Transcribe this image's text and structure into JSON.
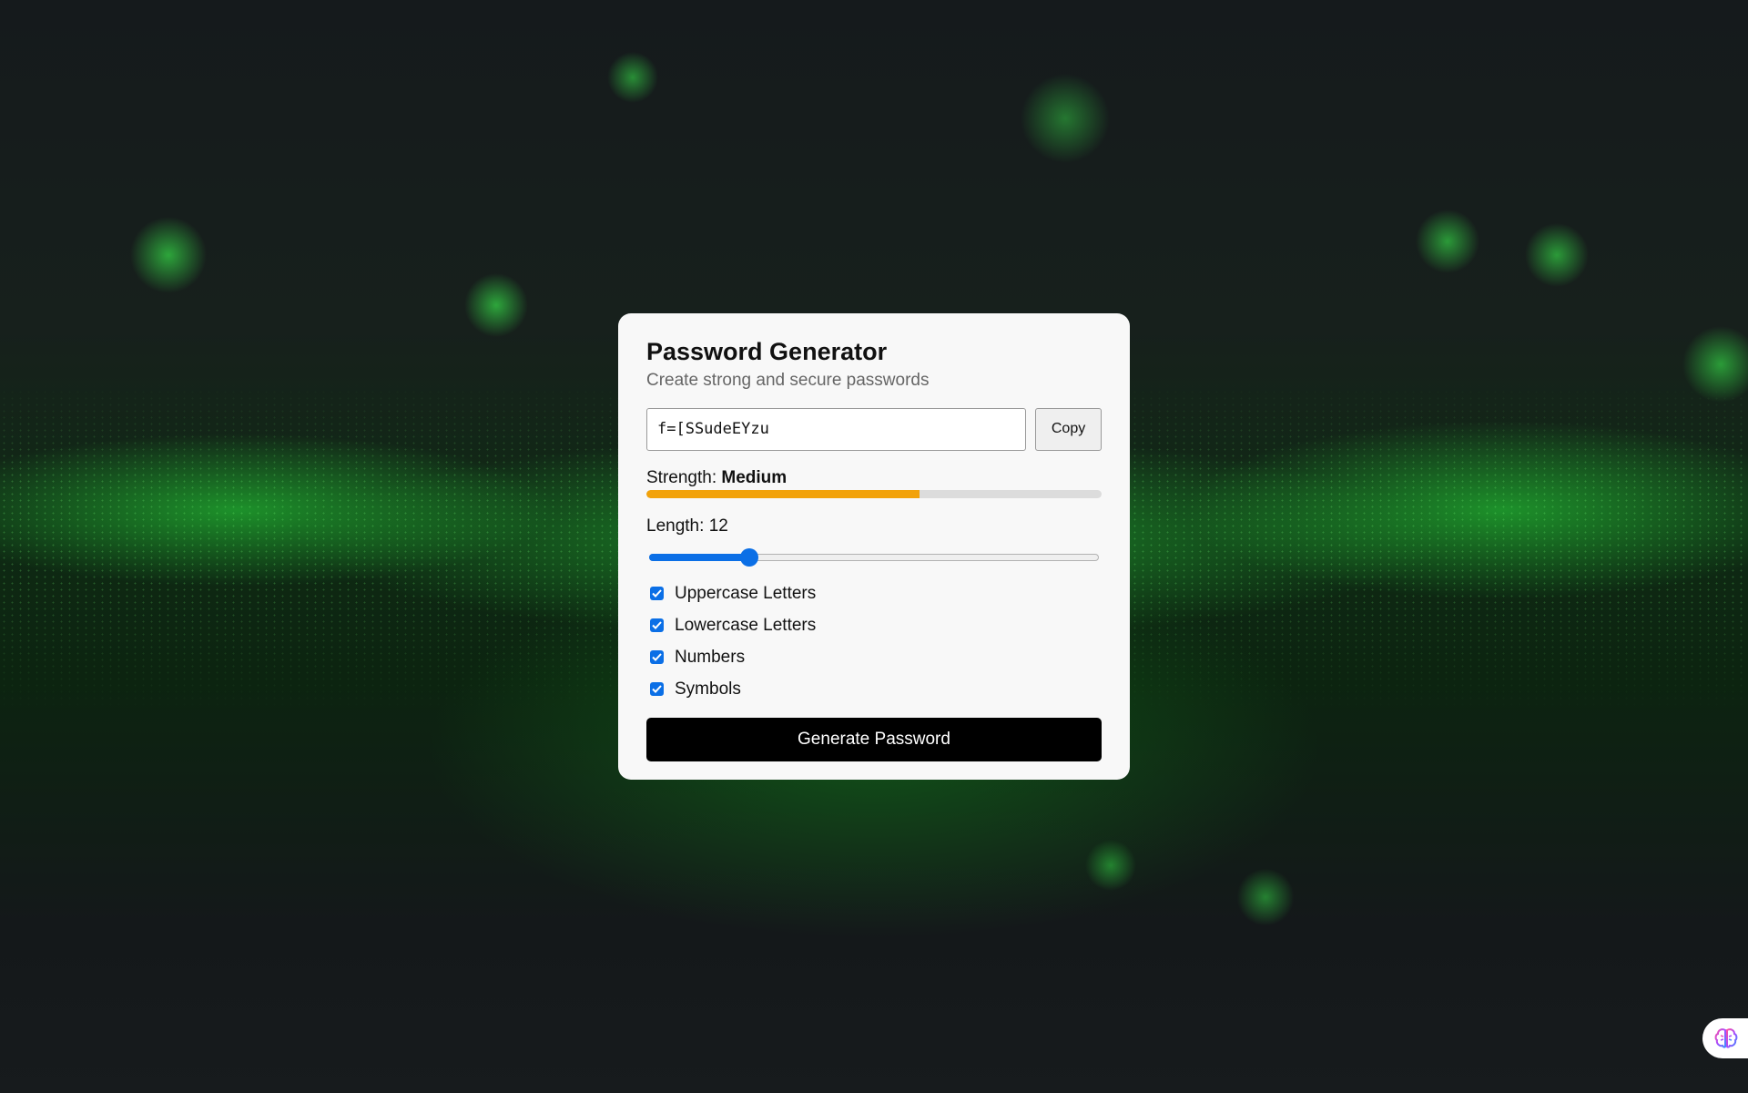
{
  "card": {
    "title": "Password Generator",
    "subtitle": "Create strong and secure passwords"
  },
  "password": {
    "value": "f=[SSudeEYzu",
    "copy_label": "Copy"
  },
  "strength": {
    "label": "Strength:",
    "value": "Medium",
    "level_percent": 60,
    "color": "#f2a20a"
  },
  "length": {
    "label": "Length:",
    "value": "12",
    "min": 4,
    "max": 40
  },
  "options": [
    {
      "label": "Uppercase Letters",
      "checked": true
    },
    {
      "label": "Lowercase Letters",
      "checked": true
    },
    {
      "label": "Numbers",
      "checked": true
    },
    {
      "label": "Symbols",
      "checked": true
    }
  ],
  "generate_label": "Generate Password",
  "colors": {
    "accent": "#0b6fe6",
    "button": "#000000",
    "card": "#f8f8f8"
  },
  "icons": {
    "fab": "brain-icon"
  }
}
